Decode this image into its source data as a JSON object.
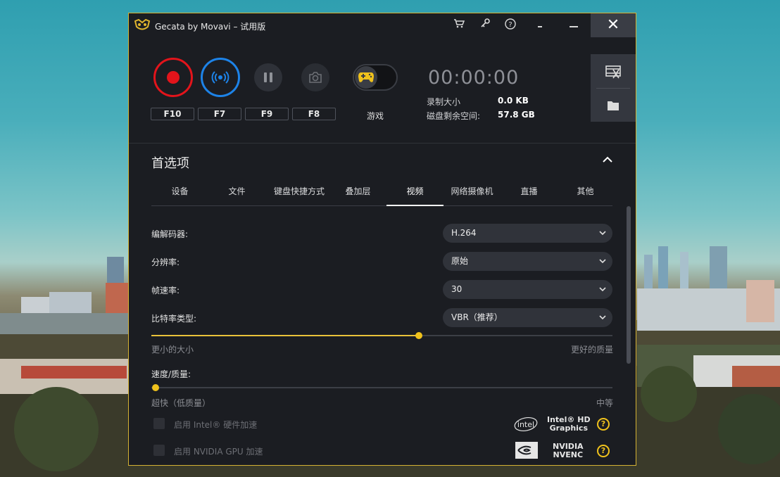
{
  "window": {
    "title": "Gecata by Movavi – 试用版",
    "accent": "#d4b233"
  },
  "titlebar": {
    "icons": [
      "cart-icon",
      "key-icon",
      "help-icon",
      "minimize-alt-icon",
      "minimize-icon",
      "close-icon"
    ],
    "close_glyph": "✕"
  },
  "hotkeys": {
    "record": "F10",
    "stream": "F7",
    "pause": "F9",
    "screenshot": "F8"
  },
  "game_mode": {
    "label": "游戏",
    "enabled": false
  },
  "timer": "00:00:00",
  "stats": {
    "size_label": "录制大小",
    "size_value": "0.0 KB",
    "disk_label": "磁盘剩余空间:",
    "disk_value": "57.8 GB"
  },
  "preferences": {
    "title": "首选项",
    "tabs": [
      "设备",
      "文件",
      "键盘快捷方式",
      "叠加层",
      "视频",
      "网络摄像机",
      "直播",
      "其他"
    ],
    "active_tab": "视频"
  },
  "video": {
    "codec_label": "编解码器:",
    "codec_value": "H.264",
    "resolution_label": "分辨率:",
    "resolution_value": "原始",
    "framerate_label": "帧速率:",
    "framerate_value": "30",
    "bitrate_label": "比特率类型:",
    "bitrate_value": "VBR（推荐）",
    "quality_level": 0.58,
    "quality_min_label": "更小的大小",
    "quality_max_label": "更好的质量",
    "speed_label": "速度/质量:",
    "speed_level": 0.0,
    "speed_min_label": "超快（低质量）",
    "speed_max_label": "中等",
    "intel_label": "启用 Intel® 硬件加速",
    "intel_brand": "intel",
    "intel_product_line1": "Intel® HD",
    "intel_product_line2": "Graphics",
    "nvidia_label": "启用 NVIDIA GPU 加速",
    "nvidia_product_line1": "NVIDIA",
    "nvidia_product_line2": "NVENC",
    "help_glyph": "?"
  },
  "colors": {
    "record": "#e3141b",
    "stream": "#1d83e8",
    "slider": "#f0c21c"
  }
}
